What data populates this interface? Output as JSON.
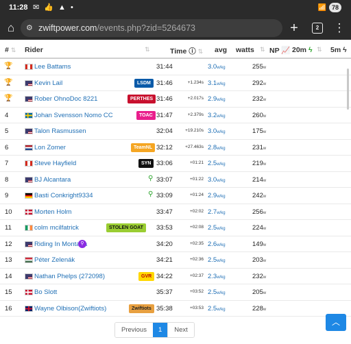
{
  "status": {
    "time": "11:28",
    "battery": "78"
  },
  "browser": {
    "url_host": "zwiftpower.com",
    "url_path": "/events.php?zid=5264673",
    "tab_count": "2"
  },
  "table": {
    "headers": {
      "pos": "#",
      "rider": "Rider",
      "time": "Time",
      "avg": "avg",
      "watts": "watts",
      "np": "NP",
      "m20": "20m",
      "m5": "5m"
    },
    "rows": [
      {
        "pos": "",
        "trophy": "gold",
        "flag": "ca",
        "name": "Lee Battams",
        "team": "",
        "time": "31:44",
        "gap": "",
        "avg": "3.0",
        "watts": "255"
      },
      {
        "pos": "",
        "trophy": "silver",
        "flag": "us",
        "name": "Kevin Lail",
        "team": "LSDM",
        "time": "31:46",
        "gap": "+1.234s",
        "avg": "3.1",
        "watts": "292"
      },
      {
        "pos": "",
        "trophy": "bronze",
        "flag": "us",
        "name": "Rober OhnoDoc 8221",
        "team": "PERTHES",
        "time": "31:46",
        "gap": "+2.017s",
        "avg": "2.9",
        "watts": "232"
      },
      {
        "pos": "4",
        "trophy": "",
        "flag": "se",
        "name": "Johan Svensson Nomo CC",
        "team": "TOAC",
        "time": "31:47",
        "gap": "+2.379s",
        "avg": "3.2",
        "watts": "260"
      },
      {
        "pos": "5",
        "trophy": "",
        "flag": "us",
        "name": "Talon Rasmussen",
        "team": "",
        "time": "32:04",
        "gap": "+19.210s",
        "avg": "3.0",
        "watts": "175"
      },
      {
        "pos": "6",
        "trophy": "",
        "flag": "nl",
        "name": "Lon Zomer",
        "team": "TeamNL",
        "time": "32:12",
        "gap": "+27.463s",
        "avg": "2.8",
        "watts": "231"
      },
      {
        "pos": "7",
        "trophy": "",
        "flag": "ca",
        "name": "Steve Hayfield",
        "team": "SYN",
        "time": "33:06",
        "gap": "+01:21",
        "avg": "2.5",
        "watts": "219"
      },
      {
        "pos": "8",
        "trophy": "",
        "flag": "us",
        "name": "BJ Alcantara",
        "team": "",
        "search": true,
        "time": "33:07",
        "gap": "+01:22",
        "avg": "3.0",
        "watts": "214"
      },
      {
        "pos": "9",
        "trophy": "",
        "flag": "de",
        "name": "Basti Conkright9334",
        "team": "",
        "search": true,
        "time": "33:09",
        "gap": "+01:24",
        "avg": "2.9",
        "watts": "242"
      },
      {
        "pos": "10",
        "trophy": "",
        "flag": "dk",
        "name": "Morten Holm",
        "team": "",
        "time": "33:47",
        "gap": "+02:02",
        "avg": "2.7",
        "watts": "256"
      },
      {
        "pos": "11",
        "trophy": "",
        "flag": "ie",
        "name": "colm mcilfatrick",
        "team": "STOLEN GOAT",
        "time": "33:53",
        "gap": "+02:08",
        "avg": "2.5",
        "watts": "224"
      },
      {
        "pos": "12",
        "trophy": "",
        "flag": "us",
        "name": "Riding In Montana",
        "team": "",
        "pin": true,
        "time": "34:20",
        "gap": "+02:35",
        "avg": "2.6",
        "watts": "149"
      },
      {
        "pos": "13",
        "trophy": "",
        "flag": "hu",
        "name": "Péter Zelenák",
        "team": "",
        "time": "34:21",
        "gap": "+02:36",
        "avg": "2.5",
        "watts": "203"
      },
      {
        "pos": "14",
        "trophy": "",
        "flag": "us",
        "name": "Nathan Phelps (272098)",
        "team": "GVR",
        "time": "34:22",
        "gap": "+02:37",
        "avg": "2.3",
        "watts": "232"
      },
      {
        "pos": "15",
        "trophy": "",
        "flag": "dk",
        "name": "Bo Slott",
        "team": "",
        "time": "35:37",
        "gap": "+03:52",
        "avg": "2.5",
        "watts": "205"
      },
      {
        "pos": "16",
        "trophy": "",
        "flag": "gb",
        "name": "Wayne Olbison(Zwiftiots)",
        "team": "Zwiftiots",
        "time": "35:38",
        "gap": "+03:53",
        "avg": "2.5",
        "watts": "228"
      }
    ],
    "units": {
      "wkg": "w/kg",
      "w": "w"
    }
  },
  "pagination": {
    "previous": "Previous",
    "current": "1",
    "next": "Next"
  }
}
